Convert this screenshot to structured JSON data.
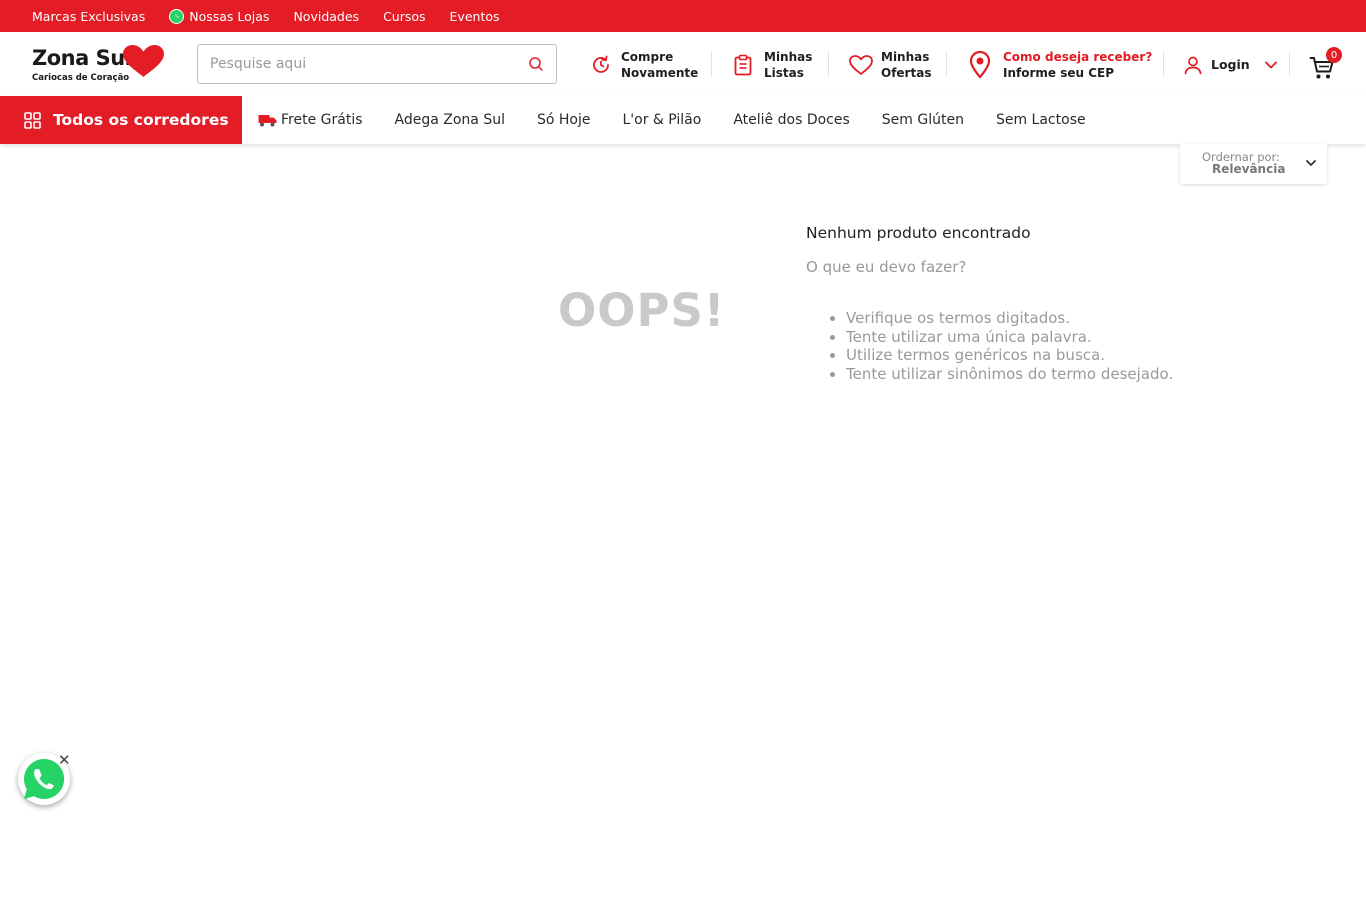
{
  "topbar": {
    "links": [
      "Marcas Exclusivas",
      "Nossas Lojas",
      "Novidades",
      "Cursos",
      "Eventos"
    ]
  },
  "brand": {
    "name": "Zona Sul",
    "tagline": "Cariocas de Coração",
    "color": "#e31c25"
  },
  "search": {
    "placeholder": "Pesquise aqui"
  },
  "header": {
    "buy_again_line1": "Compre",
    "buy_again_line2": "Novamente",
    "lists_line1": "Minhas",
    "lists_line2": "Listas",
    "offers_line1": "Minhas",
    "offers_line2": "Ofertas",
    "delivery_line1": "Como deseja receber?",
    "delivery_line2": "Informe seu CEP",
    "login": "Login",
    "cart_count": "0"
  },
  "nav": {
    "all_categories": "Todos os corredores",
    "links": [
      "Frete Grátis",
      "Adega Zona Sul",
      "Só Hoje",
      "L'or & Pilão",
      "Ateliê dos Doces",
      "Sem Glúten",
      "Sem Lactose"
    ]
  },
  "sort": {
    "label": "Ordernar por:",
    "value": "Relevância"
  },
  "empty": {
    "oops": "OOPS!",
    "title": "Nenhum produto encontrado",
    "subtitle": "O que eu devo fazer?",
    "tips": [
      "Verifique os termos digitados.",
      "Tente utilizar uma única palavra.",
      "Utilize termos genéricos na busca.",
      "Tente utilizar sinônimos do termo desejado."
    ]
  },
  "icons": {
    "whatsapp": "whatsapp-icon",
    "search": "search-icon",
    "history": "history-icon",
    "clipboard": "clipboard-icon",
    "heart": "heart-icon",
    "location": "location-pin-icon",
    "user": "user-icon",
    "cart": "cart-icon",
    "grid": "grid-icon",
    "truck": "truck-icon"
  }
}
